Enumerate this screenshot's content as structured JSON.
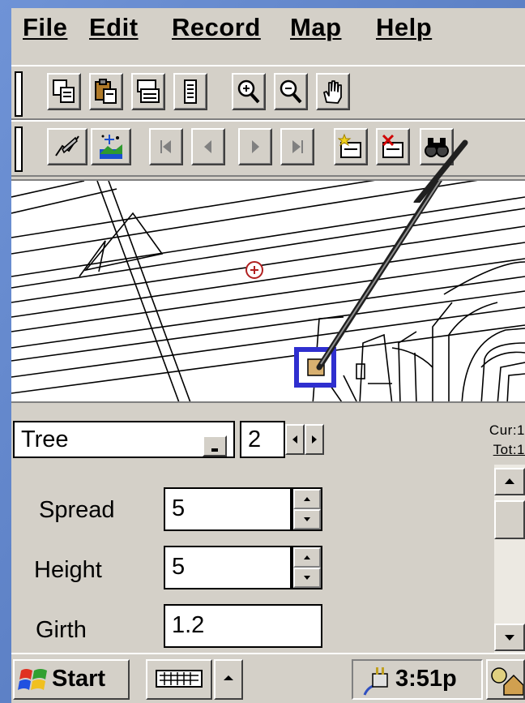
{
  "menubar": {
    "items": [
      {
        "label": "File"
      },
      {
        "label": "Edit"
      },
      {
        "label": "Record"
      },
      {
        "label": "Map"
      },
      {
        "label": "Help"
      }
    ]
  },
  "toolbar1": {
    "buttons": [
      "copy-icon",
      "paste-icon",
      "properties-icon",
      "document-icon",
      "zoom-in-icon",
      "zoom-out-icon",
      "pan-hand-icon"
    ]
  },
  "toolbar2": {
    "buttons": [
      "draw-line-icon",
      "gps-icon",
      "first-record-icon",
      "previous-record-icon",
      "next-record-icon",
      "last-record-icon",
      "new-record-icon",
      "delete-record-icon",
      "find-icon"
    ]
  },
  "record": {
    "layer": "Tree",
    "number": "2",
    "cur_label": "Cur:1",
    "tot_label": "Tot:1"
  },
  "form": {
    "fields": [
      {
        "label": "Spread",
        "value": "5"
      },
      {
        "label": "Height",
        "value": "5"
      },
      {
        "label": "Girth",
        "value": "1.2"
      }
    ]
  },
  "taskbar": {
    "start_label": "Start",
    "clock": "3:51p"
  },
  "colors": {
    "background": "#5c7fc4",
    "chrome": "#d4d0c8",
    "selection": "#2f2fcf"
  }
}
